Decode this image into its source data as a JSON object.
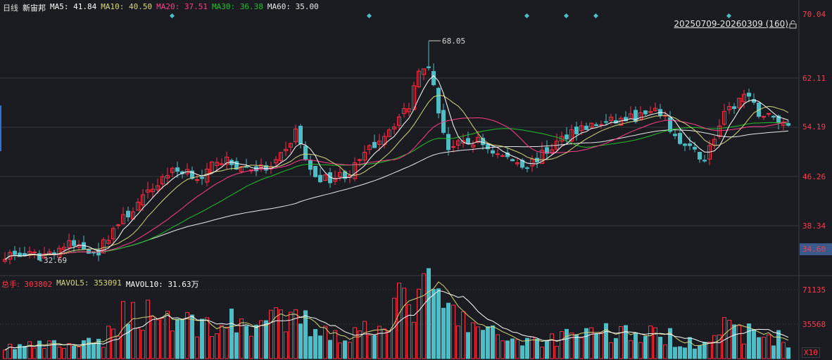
{
  "header": {
    "period": "日线",
    "stock_name": "新宙邦",
    "ma": [
      {
        "label": "MA5:",
        "value": "41.84",
        "color": "#ffffff"
      },
      {
        "label": "MA10:",
        "value": "40.50",
        "color": "#d6d67a"
      },
      {
        "label": "MA20:",
        "value": "37.51",
        "color": "#ff3d8b"
      },
      {
        "label": "MA30:",
        "value": "36.38",
        "color": "#22c02a"
      },
      {
        "label": "MA60:",
        "value": "35.00",
        "color": "#e8e8e8"
      }
    ],
    "range": "20250709-20260309 (160)"
  },
  "volume_legend": {
    "label": "总手:",
    "value": "303802",
    "mavol5_label": "MAVOL5:",
    "mavol5": "353091",
    "mavol10_label": "MAVOL10:",
    "mavol10": "31.63万"
  },
  "axis": {
    "price_labels": [
      "70.04",
      "62.11",
      "54.19",
      "46.26",
      "38.34"
    ],
    "current_price": "34.60",
    "volume_labels": [
      "71135",
      "35568"
    ],
    "volume_unit": "X10"
  },
  "annotations": {
    "high": "68.05",
    "low": "32.69"
  },
  "colors": {
    "up": "#ff2d46",
    "down": "#4dbdc6",
    "bg": "#1a1c21"
  },
  "chart_data": {
    "type": "candlestick",
    "count": 160,
    "price_range": [
      32.69,
      68.05
    ],
    "close_keypoints": [
      [
        0,
        33.7
      ],
      [
        7,
        33.4
      ],
      [
        13,
        35.3
      ],
      [
        19,
        34.2
      ],
      [
        22,
        37.9
      ],
      [
        27,
        41.8
      ],
      [
        33,
        46.9
      ],
      [
        37,
        47.3
      ],
      [
        40,
        45.5
      ],
      [
        43,
        49.2
      ],
      [
        48,
        47.7
      ],
      [
        54,
        47.5
      ],
      [
        57,
        50.3
      ],
      [
        59,
        53.7
      ],
      [
        62,
        46.9
      ],
      [
        65,
        45.8
      ],
      [
        70,
        46.9
      ],
      [
        75,
        51.5
      ],
      [
        79,
        54.9
      ],
      [
        82,
        57.7
      ],
      [
        84,
        63.9
      ],
      [
        86,
        64.5
      ],
      [
        88,
        56.6
      ],
      [
        90,
        50.9
      ],
      [
        96,
        52.0
      ],
      [
        100,
        49.8
      ],
      [
        106,
        48.1
      ],
      [
        110,
        50.3
      ],
      [
        115,
        53.7
      ],
      [
        122,
        54.9
      ],
      [
        129,
        56.0
      ],
      [
        133,
        56.6
      ],
      [
        137,
        51.5
      ],
      [
        142,
        49.2
      ],
      [
        146,
        56.0
      ],
      [
        150,
        59.4
      ],
      [
        153,
        56.6
      ],
      [
        159,
        54.6
      ]
    ],
    "volume_keypoints": [
      [
        0,
        12000
      ],
      [
        20,
        15000
      ],
      [
        22,
        40000
      ],
      [
        28,
        50000
      ],
      [
        40,
        35000
      ],
      [
        60,
        38000
      ],
      [
        70,
        22000
      ],
      [
        80,
        55000
      ],
      [
        86,
        68000
      ],
      [
        92,
        40000
      ],
      [
        100,
        22000
      ],
      [
        110,
        18000
      ],
      [
        116,
        30000
      ],
      [
        130,
        25000
      ],
      [
        140,
        18000
      ],
      [
        146,
        30000
      ],
      [
        159,
        20000
      ]
    ],
    "diamond_markers": [
      34,
      74,
      106,
      114,
      120,
      147
    ]
  }
}
